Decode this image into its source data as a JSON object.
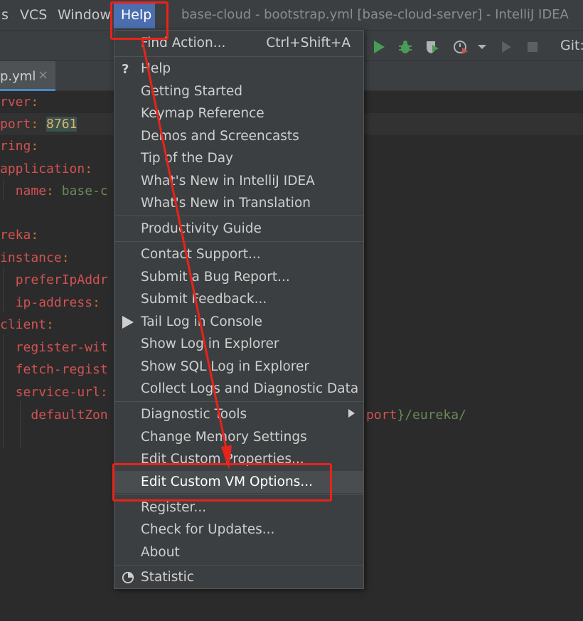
{
  "menubar": {
    "items": [
      {
        "label": "s"
      },
      {
        "label": "VCS"
      },
      {
        "label": "Window"
      },
      {
        "label": "Help"
      }
    ],
    "window_title": "base-cloud - bootstrap.yml [base-cloud-server] - IntelliJ IDEA"
  },
  "toolbar": {
    "icons": [
      "run-icon",
      "debug-icon",
      "coverage-icon",
      "profile-icon",
      "dropdown-icon",
      "resume-icon",
      "stop-icon"
    ],
    "git_label": "Git:"
  },
  "tabs": {
    "active_label": "p.yml",
    "close_glyph": "×"
  },
  "editor": {
    "lines": [
      {
        "indent": "",
        "key": "rver",
        "sep": ":",
        "value": ""
      },
      {
        "indent": "",
        "key": "port",
        "sep": ": ",
        "value": "8761"
      },
      {
        "indent": "",
        "key": "ring",
        "sep": ":",
        "value": ""
      },
      {
        "indent": "",
        "key": "application",
        "sep": ":",
        "value": ""
      },
      {
        "indent": "  ",
        "key": "name",
        "sep": ": ",
        "value": "base-c"
      },
      {
        "indent": "",
        "key": "",
        "sep": "",
        "value": ""
      },
      {
        "indent": "",
        "key": "reka",
        "sep": ":",
        "value": ""
      },
      {
        "indent": "",
        "key": "instance",
        "sep": ":",
        "value": ""
      },
      {
        "indent": "  ",
        "key": "preferIpAddr",
        "sep": "",
        "value": ""
      },
      {
        "indent": "  ",
        "key": "ip-address",
        "sep": ":",
        "value": ""
      },
      {
        "indent": "",
        "key": "client",
        "sep": ":",
        "value": ""
      },
      {
        "indent": "  ",
        "key": "register-wit",
        "sep": "",
        "value": ""
      },
      {
        "indent": "  ",
        "key": "fetch-regist",
        "sep": "",
        "value": ""
      },
      {
        "indent": "  ",
        "key": "service-url:",
        "sep": "",
        "value": ""
      },
      {
        "indent": "    ",
        "key": "defaultZon",
        "sep": "",
        "value": ""
      }
    ],
    "trailing_text_key": "port",
    "trailing_text_rest": "}/eureka/"
  },
  "help_menu": {
    "find_action": {
      "label": "Find Action...",
      "shortcut": "Ctrl+Shift+A"
    },
    "help": "Help",
    "getting_started": "Getting Started",
    "keymap_reference": "Keymap Reference",
    "demos": "Demos and Screencasts",
    "tip_of_day": "Tip of the Day",
    "whats_new": "What's New in IntelliJ IDEA",
    "whats_new_translation": "What's New in Translation",
    "productivity_guide": "Productivity Guide",
    "contact_support": "Contact Support...",
    "submit_bug": "Submit a Bug Report...",
    "submit_feedback": "Submit Feedback...",
    "tail_log": "Tail Log in Console",
    "show_log": "Show Log in Explorer",
    "show_sql_log": "Show SQL Log in Explorer",
    "collect_logs": "Collect Logs and Diagnostic Data",
    "diagnostic_tools": "Diagnostic Tools",
    "change_memory": "Change Memory Settings",
    "edit_custom_props": "Edit Custom Properties...",
    "edit_custom_vm": "Edit Custom VM Options...",
    "register": "Register...",
    "check_updates": "Check for Updates...",
    "about": "About",
    "statistic": "Statistic"
  },
  "colors": {
    "annotation_red": "#e8231a",
    "menu_bg": "#3c3f41",
    "editor_bg": "#2b2b2b",
    "accent_blue": "#4b6eaf"
  }
}
